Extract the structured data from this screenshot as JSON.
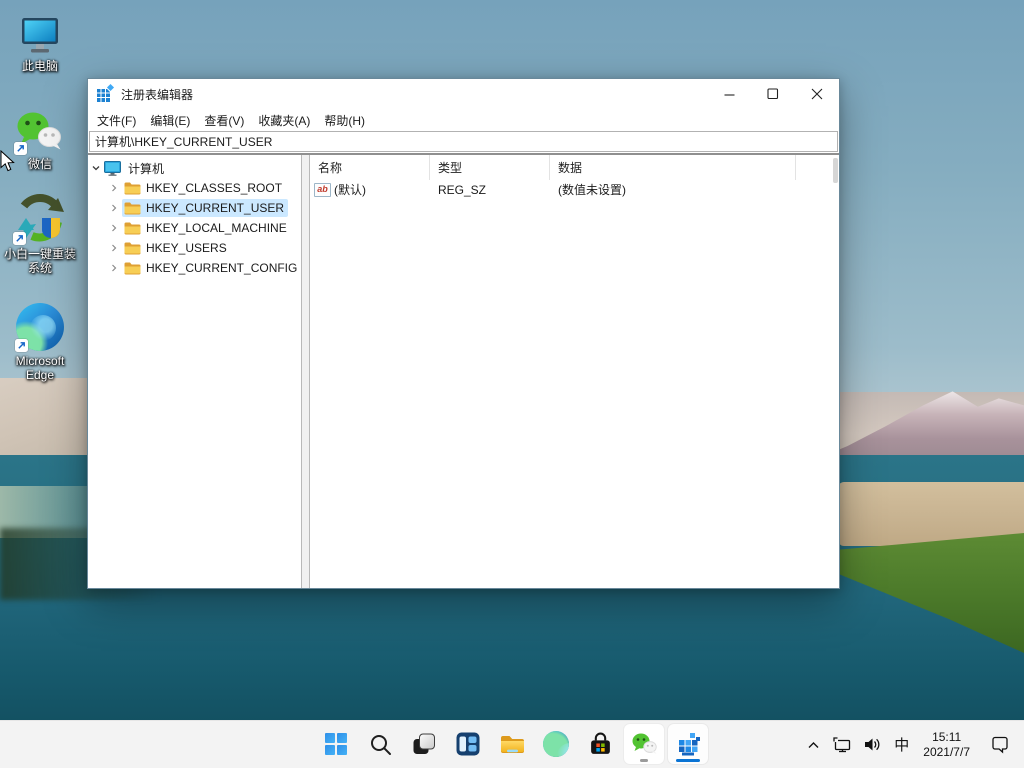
{
  "colors": {
    "accent": "#0b74d4",
    "selection": "#cbe8ff",
    "taskbar": "#f3f3f3",
    "window_border": "#69889a"
  },
  "desktop": {
    "icons": [
      {
        "label": "此电脑"
      },
      {
        "label": "微信"
      },
      {
        "label": "小白一键重装系统"
      },
      {
        "label": "Microsoft Edge"
      }
    ]
  },
  "window": {
    "title": "注册表编辑器",
    "controls": {
      "minimize": "minimize",
      "maximize": "maximize",
      "close": "close"
    },
    "menu": [
      "文件(F)",
      "编辑(E)",
      "查看(V)",
      "收藏夹(A)",
      "帮助(H)"
    ],
    "address": "计算机\\HKEY_CURRENT_USER",
    "tree": {
      "root": "计算机",
      "items": [
        "HKEY_CLASSES_ROOT",
        "HKEY_CURRENT_USER",
        "HKEY_LOCAL_MACHINE",
        "HKEY_USERS",
        "HKEY_CURRENT_CONFIG"
      ],
      "selected": "HKEY_CURRENT_USER"
    },
    "list": {
      "columns": [
        "名称",
        "类型",
        "数据"
      ],
      "string_icon_label": "ab",
      "rows": [
        {
          "name": "(默认)",
          "type": "REG_SZ",
          "data": "(数值未设置)"
        }
      ]
    }
  },
  "taskbar": {
    "buttons": [
      "start",
      "search",
      "task-view",
      "widgets",
      "file-explorer",
      "edge",
      "store",
      "wechat",
      "registry-editor"
    ],
    "tray": {
      "ime": "中",
      "time": "15:11",
      "date": "2021/7/7"
    }
  }
}
